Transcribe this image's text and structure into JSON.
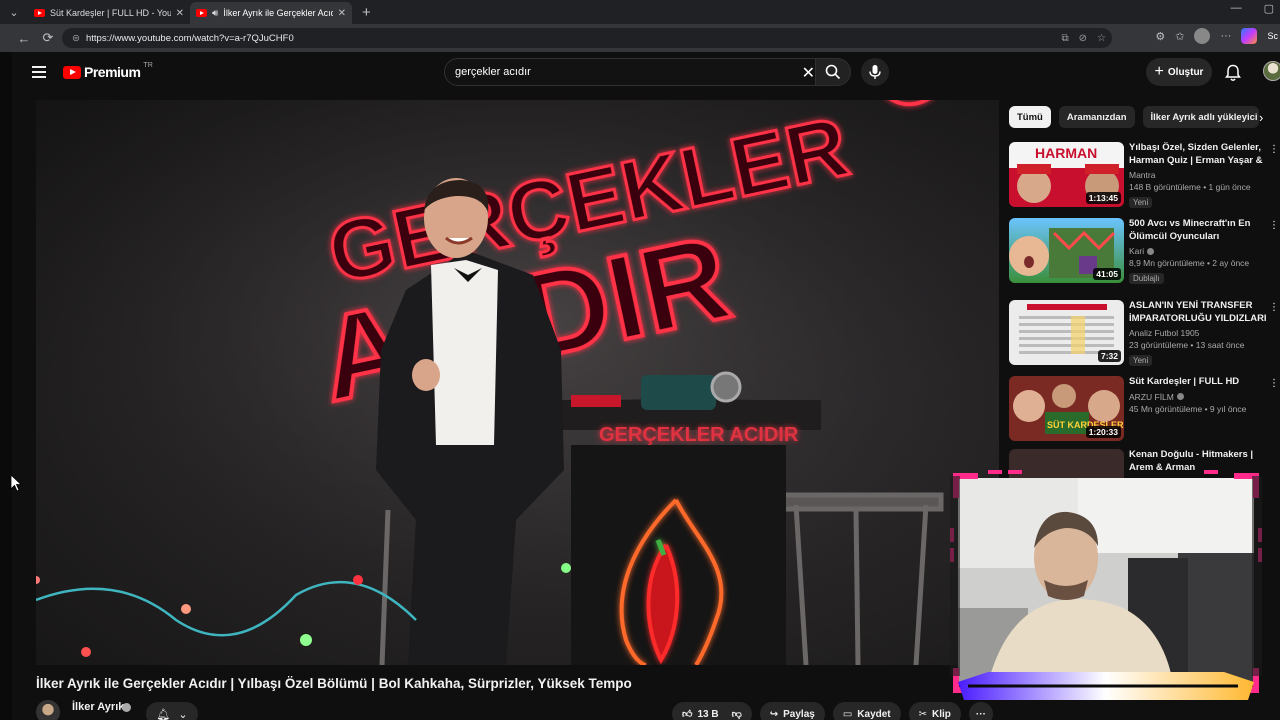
{
  "browser": {
    "tabs": [
      {
        "title": "Süt Kardeşler | FULL HD - YouTube",
        "close": "✕"
      },
      {
        "title": "İlker Ayrık ile Gerçekler Acıdır",
        "close": "✕"
      }
    ],
    "new_tab": "+",
    "window_controls": [
      "—",
      "▢"
    ],
    "url": "https://www.youtube.com/watch?v=a-r7QJuCHF0",
    "copilot_label": "Sc"
  },
  "youtube": {
    "logo_text": "Premium",
    "logo_region": "TR",
    "search_query": "gerçekler acıdır",
    "create_label": "Oluştur"
  },
  "video": {
    "title": "İlker Ayrık ile Gerçekler Acıdır | Yılbaşı Özel Bölümü | Bol Kahkaha, Sürprizler, Yüksek Tempo",
    "scene_sign_top": "GERÇEKLER",
    "scene_sign_bottom": "ACIDIR",
    "podium_text": "GERÇEKLER ACIDIR",
    "channel_name": "İlker Ayrık",
    "likes": "13 B",
    "share_label": "Paylaş",
    "save_label": "Kaydet",
    "clip_label": "Klip"
  },
  "sidebar": {
    "chips": [
      "Tümü",
      "Aramanızdan",
      "İlker Ayrık adlı yükleyici"
    ],
    "recommendations": [
      {
        "title": "Yılbaşı Özel, Sizden Gelenler, Harman Quiz | Erman Yaşar & ...",
        "channel": "Mantra",
        "verified": false,
        "meta": "148 B görüntüleme • 1 gün önce",
        "badge": "Yeni",
        "duration": "1:13:45",
        "thumb_text": "HARMAN",
        "thumb_color": "#c8102e"
      },
      {
        "title": "500 Avcı vs Minecraft'ın En Ölümcül Oyuncuları",
        "channel": "Kari",
        "verified": true,
        "meta": "8,9 Mn görüntüleme • 2 ay önce",
        "badge": "Dublajlı",
        "duration": "41:05",
        "thumb_text": "",
        "thumb_color": "#3a8f3a"
      },
      {
        "title": "ASLAN'IN YENİ TRANSFER İMPARATORLUĞU YILDIZLARI",
        "channel": "Analiz Futbol 1905",
        "verified": false,
        "meta": "23 görüntüleme • 13 saat önce",
        "badge": "Yeni",
        "duration": "7:32",
        "thumb_text": "",
        "thumb_color": "#e9e9e9"
      },
      {
        "title": "Süt Kardeşler | FULL HD",
        "channel": "ARZU FİLM",
        "verified": true,
        "meta": "45 Mn görüntüleme • 9 yıl önce",
        "badge": "",
        "duration": "1:20:33",
        "thumb_text": "SÜT KARDEŞLER",
        "thumb_color": "#7a2a22"
      },
      {
        "title": "Kenan Doğulu - Hitmakers | Arem & Arman",
        "channel": "",
        "verified": false,
        "meta": "",
        "badge": "",
        "duration": "",
        "thumb_text": "",
        "thumb_color": "#3a2a2a"
      }
    ]
  },
  "colors": {
    "brand": "#ff0000",
    "bg": "#0f0f0f",
    "chip_bg": "#272727",
    "neon": "#ff3347",
    "webcam_frame": "#ff2a8a"
  }
}
